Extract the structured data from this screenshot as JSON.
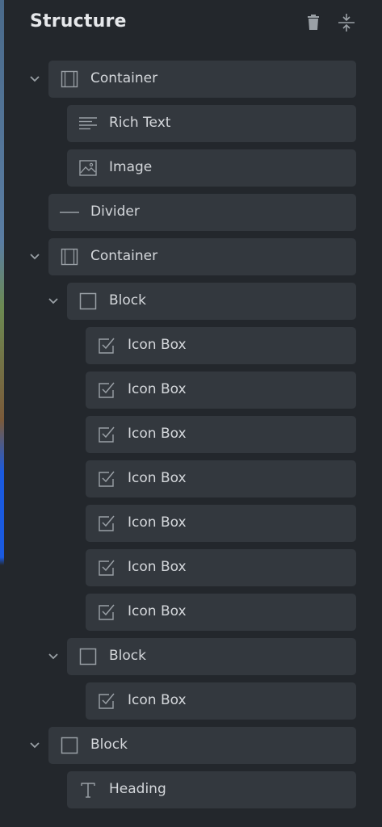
{
  "panel": {
    "title": "Structure",
    "header_icons": [
      "trash-icon",
      "collapse-icon"
    ]
  },
  "tree": [
    {
      "label": "Container",
      "icon": "container-icon",
      "expanded": true
    },
    {
      "label": "Rich Text",
      "icon": "rich-text-icon"
    },
    {
      "label": "Image",
      "icon": "image-icon"
    },
    {
      "label": "Divider",
      "icon": "divider-icon"
    },
    {
      "label": "Container",
      "icon": "container-icon",
      "expanded": true
    },
    {
      "label": "Block",
      "icon": "block-icon",
      "expanded": true
    },
    {
      "label": "Icon Box",
      "icon": "icon-box-icon"
    },
    {
      "label": "Icon Box",
      "icon": "icon-box-icon"
    },
    {
      "label": "Icon Box",
      "icon": "icon-box-icon"
    },
    {
      "label": "Icon Box",
      "icon": "icon-box-icon"
    },
    {
      "label": "Icon Box",
      "icon": "icon-box-icon"
    },
    {
      "label": "Icon Box",
      "icon": "icon-box-icon"
    },
    {
      "label": "Icon Box",
      "icon": "icon-box-icon"
    },
    {
      "label": "Block",
      "icon": "block-icon",
      "expanded": true
    },
    {
      "label": "Icon Box",
      "icon": "icon-box-icon"
    },
    {
      "label": "Block",
      "icon": "block-icon",
      "expanded": true
    },
    {
      "label": "Heading",
      "icon": "heading-icon"
    }
  ]
}
